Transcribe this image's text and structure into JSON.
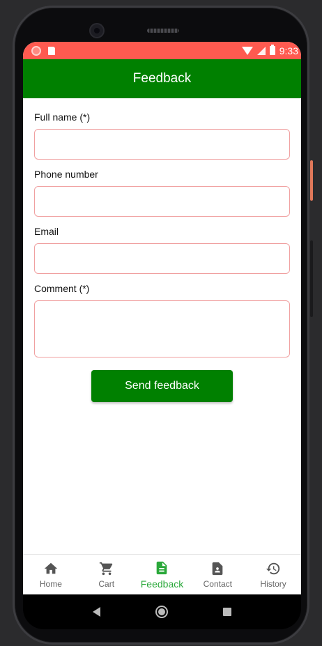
{
  "status_bar": {
    "time": "9:33"
  },
  "app_bar": {
    "title": "Feedback"
  },
  "form": {
    "full_name": {
      "label": "Full name (*)",
      "value": "",
      "placeholder": ""
    },
    "phone": {
      "label": "Phone number",
      "value": "",
      "placeholder": ""
    },
    "email": {
      "label": "Email",
      "value": "",
      "placeholder": ""
    },
    "comment": {
      "label": "Comment (*)",
      "value": "",
      "placeholder": ""
    },
    "submit_label": "Send feedback"
  },
  "bottom_nav": {
    "items": [
      {
        "label": "Home",
        "icon": "home-icon"
      },
      {
        "label": "Cart",
        "icon": "cart-icon"
      },
      {
        "label": "Feedback",
        "icon": "document-icon",
        "active": true
      },
      {
        "label": "Contact",
        "icon": "contact-icon"
      },
      {
        "label": "History",
        "icon": "history-icon"
      }
    ]
  },
  "colors": {
    "status_bar": "#ff5a50",
    "primary": "#008000",
    "active_tab": "#2aa83a",
    "input_border": "#f0a0a0"
  }
}
